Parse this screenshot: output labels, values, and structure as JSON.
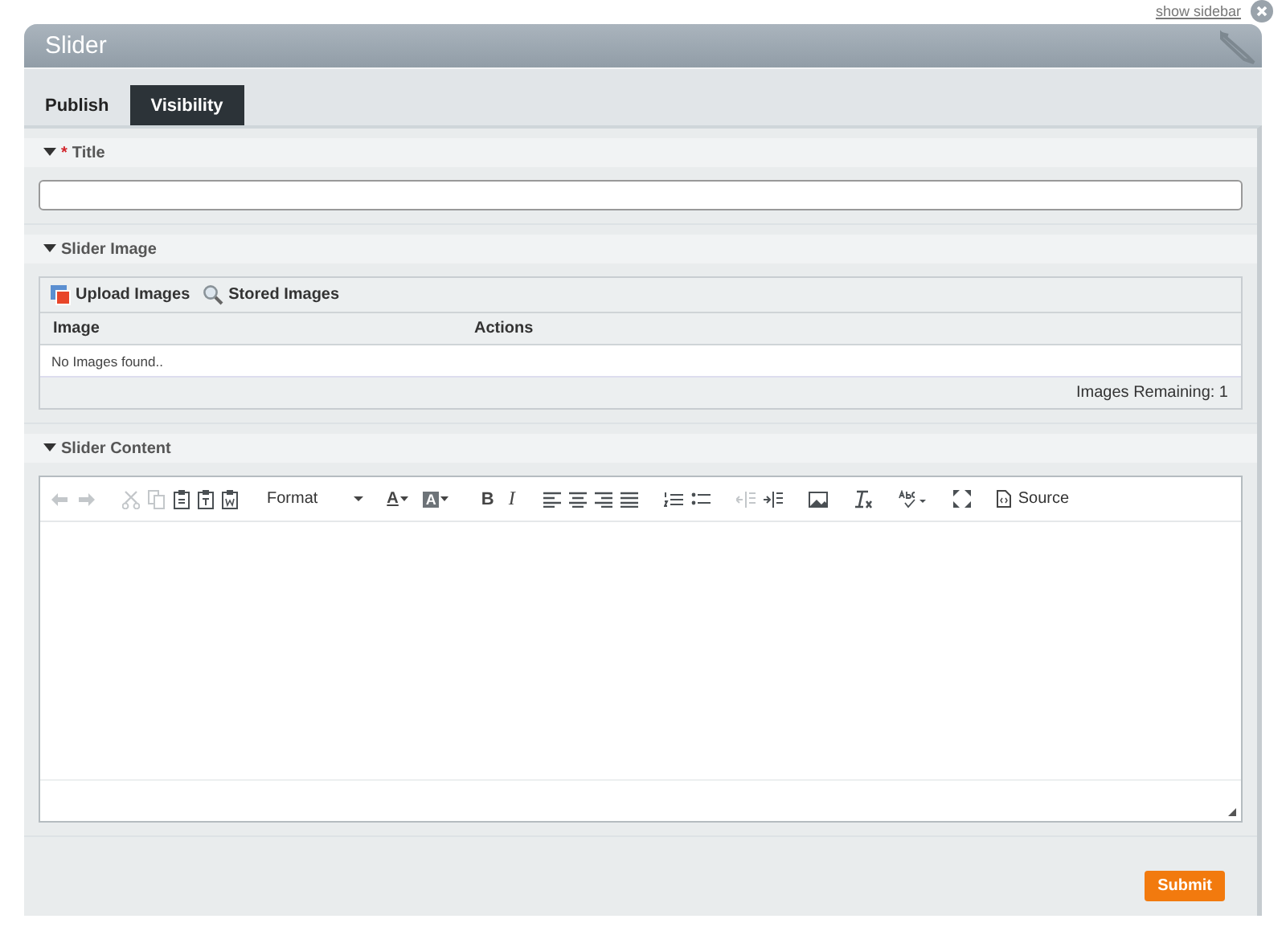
{
  "top_link": "show sidebar",
  "window": {
    "title": "Slider"
  },
  "tabs": [
    {
      "label": "Publish",
      "selected": false
    },
    {
      "label": "Visibility",
      "selected": true
    }
  ],
  "sections": [
    {
      "kind": "text",
      "title": "Title",
      "required_mark": "*",
      "expanded": true
    },
    {
      "kind": "images",
      "title": "Slider Image",
      "expanded": true,
      "actions": [
        "Upload Images",
        "Stored Images"
      ],
      "columns": [
        "Image",
        "Actions"
      ],
      "empty": "No Images found..",
      "remaining": "Images Remaining: 1"
    },
    {
      "kind": "editor",
      "title": "Slider Content",
      "expanded": true,
      "toolbar": {
        "undo_disabled": true,
        "redo_disabled": true,
        "cut_disabled": true,
        "copy_disabled": true,
        "outdent_disabled": true,
        "format": "Format",
        "text_color": "A",
        "bg_color": "A",
        "bold": "B",
        "italic": "I",
        "source": "Source"
      }
    }
  ],
  "submit": "Submit"
}
